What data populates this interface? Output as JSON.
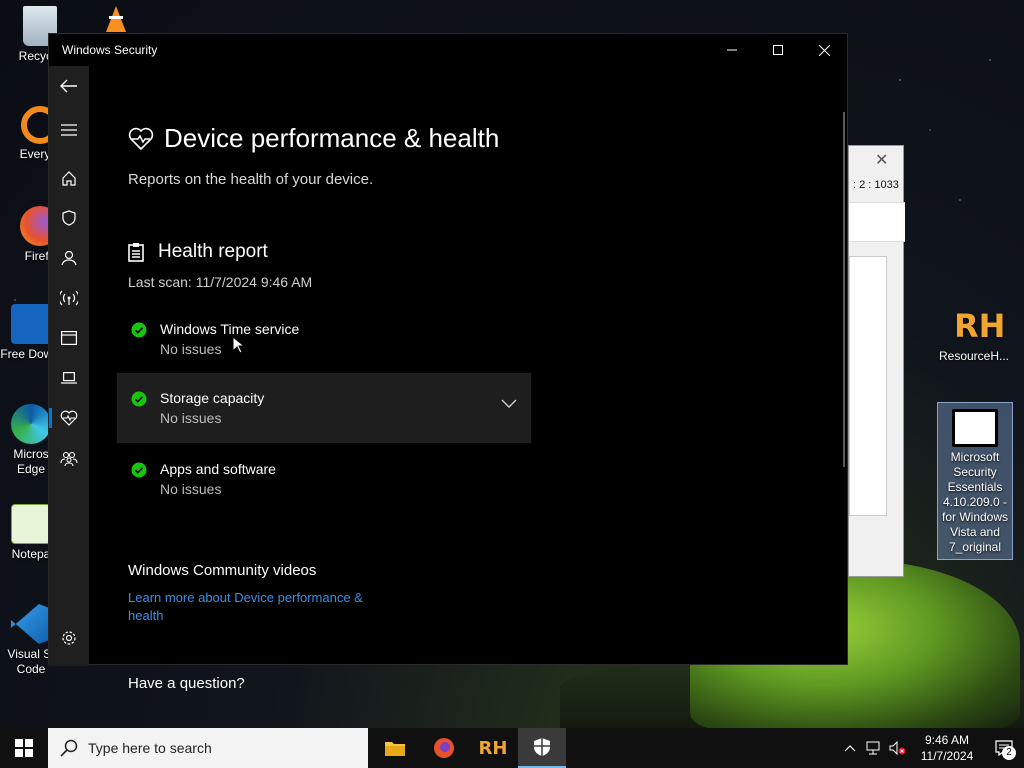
{
  "desktop": {
    "icons": [
      {
        "label": "Recycle"
      },
      {
        "label": "Everyth"
      },
      {
        "label": "Firefo"
      },
      {
        "label": "Free Downl"
      },
      {
        "label": "Micros Edge"
      },
      {
        "label": "Notepa"
      },
      {
        "label": "Visual St Code"
      },
      {
        "label": "ResourceH..."
      },
      {
        "label": "Microsoft Security Essentials 4.10.209.0 - for Windows Vista and 7_original"
      }
    ],
    "background_window": {
      "coords_text": ": 2 : 1033"
    }
  },
  "window": {
    "title": "Windows Security",
    "page_title": "Device performance & health",
    "page_subtitle": "Reports on the health of your device.",
    "health_report": {
      "title": "Health report",
      "last_scan": "Last scan: 11/7/2024 9:46 AM",
      "items": [
        {
          "name": "Windows Time service",
          "status": "No issues"
        },
        {
          "name": "Storage capacity",
          "status": "No issues"
        },
        {
          "name": "Apps and software",
          "status": "No issues"
        }
      ]
    },
    "community": {
      "title": "Windows Community videos",
      "link": "Learn more about Device performance & health"
    },
    "question": "Have a question?"
  },
  "taskbar": {
    "search_placeholder": "Type here to search",
    "time": "9:46 AM",
    "date": "11/7/2024",
    "notification_count": "2"
  },
  "colors": {
    "accent": "#0078d7",
    "check_green": "#16c60c",
    "link": "#3a8ee6"
  }
}
